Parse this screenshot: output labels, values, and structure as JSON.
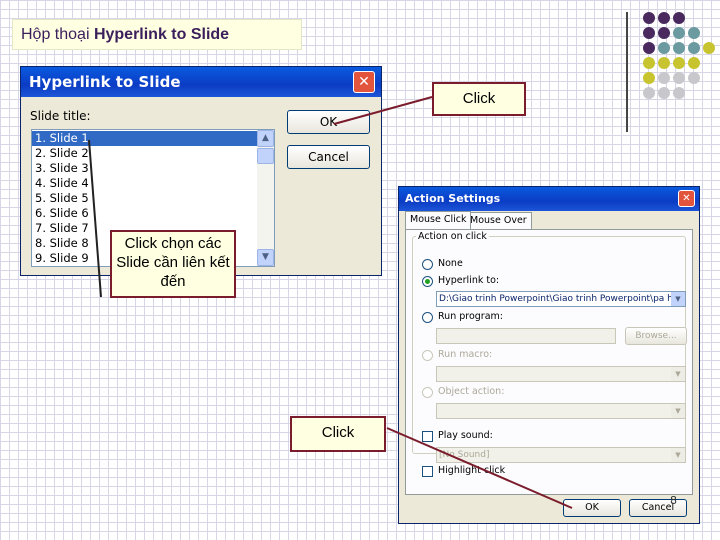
{
  "slide": {
    "title_prefix": "Hộp thoại ",
    "title_bold": "Hyperlink to Slide",
    "page_number": "8"
  },
  "hyperlink_dialog": {
    "title": "Hyperlink to Slide",
    "close_glyph": "✕",
    "slide_title_label": "Slide title:",
    "slides": [
      "1. Slide 1",
      "2. Slide 2",
      "3. Slide 3",
      "4. Slide 4",
      "5. Slide 5",
      "6. Slide 6",
      "7. Slide 7",
      "8. Slide 8",
      "9. Slide 9"
    ],
    "selected_index": 0,
    "ok_label": "OK",
    "cancel_label": "Cancel"
  },
  "action_settings": {
    "title": "Action Settings",
    "close_glyph": "✕",
    "tabs": [
      "Mouse Click",
      "Mouse Over"
    ],
    "group_label": "Action on click",
    "none_label": "None",
    "hyperlink_label": "Hyperlink to:",
    "hyperlink_value": "D:\\Giao trinh Powerpoint\\Giao trinh Powerpoint\\pa hoan g",
    "run_program_label": "Run program:",
    "browse_label": "Browse...",
    "run_macro_label": "Run macro:",
    "object_action_label": "Object action:",
    "play_sound_label": "Play sound:",
    "sound_value": "[No Sound]",
    "highlight_label": "Highlight click",
    "ok_label": "OK",
    "cancel_label": "Cancel"
  },
  "callouts": {
    "click_top": "Click",
    "choose_slide": "Click chọn các Slide cần liên kết đến",
    "click_bottom": "Click"
  },
  "colors": {
    "accent_purple": "#4a2a5e",
    "accent_teal": "#6b9aa0",
    "accent_olive": "#c8c430",
    "accent_gray": "#c8c8cc",
    "callout_border": "#7b1c2c"
  }
}
